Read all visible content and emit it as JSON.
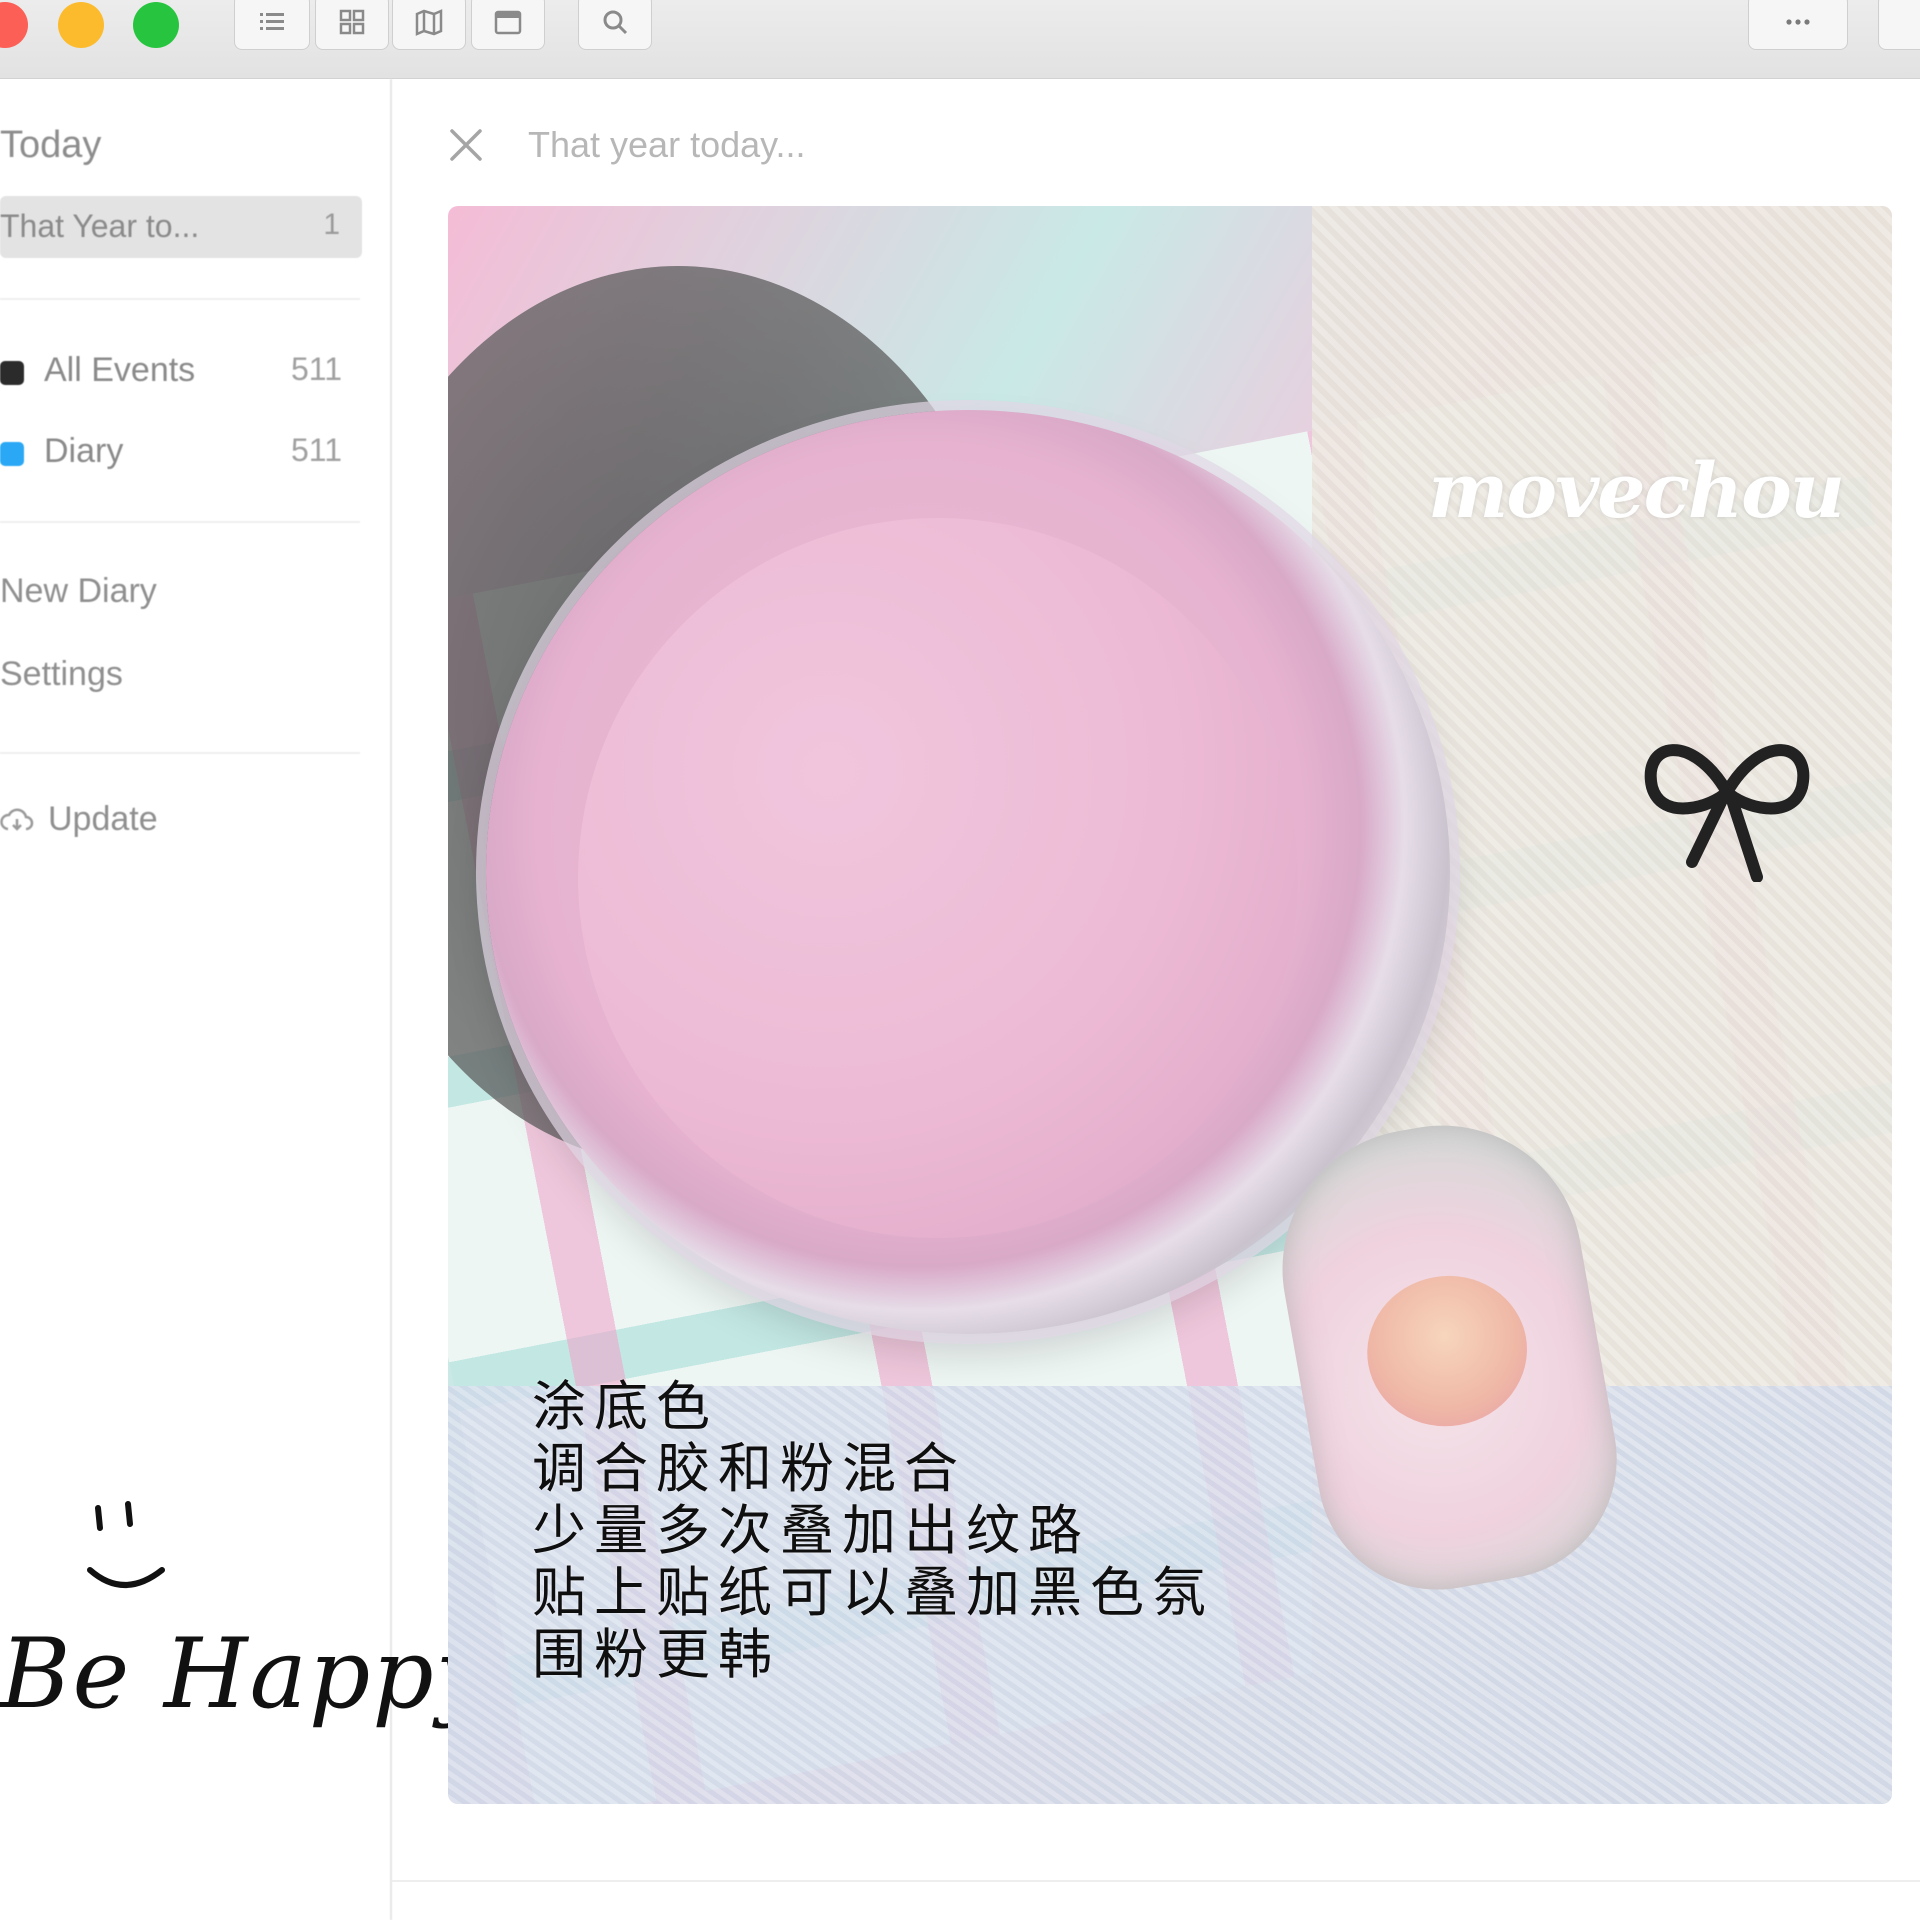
{
  "titlebar": {
    "buttons": [
      "list-icon",
      "grid-icon",
      "map-icon",
      "calendar-icon",
      "search-icon",
      "more-icon"
    ]
  },
  "sidebar": {
    "heading": "Today",
    "selected": {
      "label": "That Year to...",
      "count": "1"
    },
    "journals": [
      {
        "label": "All Events",
        "count": "511",
        "color": "#2b2b2b"
      },
      {
        "label": "Diary",
        "count": "511",
        "color": "#2aa8f5"
      }
    ],
    "new_diary": "New Diary",
    "settings": "Settings",
    "update": "Update"
  },
  "overlay": {
    "handwriting": "Be Happy"
  },
  "main": {
    "title_placeholder": "That year today...",
    "photo": {
      "watermark": "movechou",
      "caption": [
        "涂底色",
        "调合胶和粉混合",
        "少量多次叠加出纹路",
        "贴上贴纸可以叠加黑色氛",
        "围粉更韩"
      ]
    }
  }
}
